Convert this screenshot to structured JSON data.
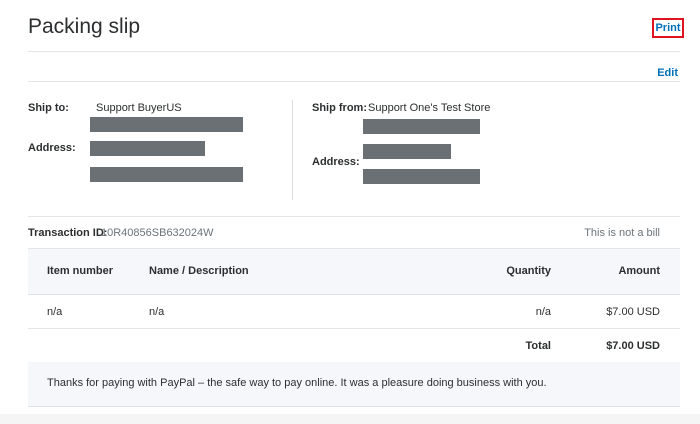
{
  "header": {
    "title": "Packing slip",
    "print_label": "Print",
    "edit_label": "Edit"
  },
  "ship_to": {
    "label": "Ship to:",
    "name": "Support BuyerUS",
    "address_label": "Address:"
  },
  "ship_from": {
    "label": "Ship from:",
    "name": "Support One's Test Store",
    "address_label": "Address:"
  },
  "transaction": {
    "label": "Transaction ID:",
    "id": "10R40856SB632024W",
    "note": "This is not a bill"
  },
  "table": {
    "headers": {
      "item_number": "Item number",
      "name_desc": "Name / Description",
      "quantity": "Quantity",
      "amount": "Amount"
    },
    "rows": [
      {
        "item_number": "n/a",
        "name_desc": "n/a",
        "quantity": "n/a",
        "amount": "$7.00 USD"
      }
    ],
    "total": {
      "label": "Total",
      "amount": "$7.00 USD"
    }
  },
  "footer": {
    "message": "Thanks for paying with PayPal – the safe way to pay online. It was a pleasure doing business with you."
  },
  "colors": {
    "accent": "#0070ba",
    "highlight_border": "#e0141e",
    "redaction": "#6b7075"
  }
}
